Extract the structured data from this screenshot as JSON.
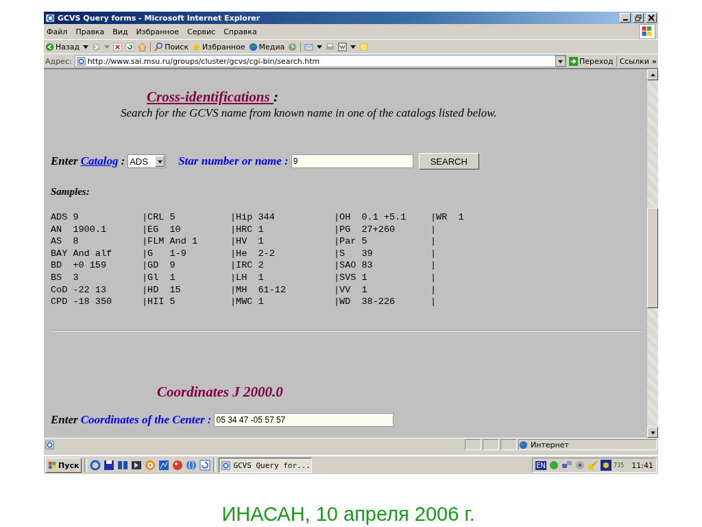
{
  "window": {
    "title": "GCVS Query forms - Microsoft Internet Explorer"
  },
  "menu": [
    "Файл",
    "Правка",
    "Вид",
    "Избранное",
    "Сервис",
    "Справка"
  ],
  "toolbar": {
    "back": "Назад",
    "search": "Поиск",
    "favorites": "Избранное",
    "media": "Медиа"
  },
  "address_bar": {
    "label": "Адрес:",
    "url": "http://www.sai.msu.ru/groups/cluster/gcvs/cgi-bin/search.htm",
    "go": "Переход",
    "links": "Ссылки",
    "more": "»"
  },
  "page": {
    "cross_title": "Cross-identifications ",
    "cross_colon": ":",
    "cross_subtitle": "Search for the GCVS name from known name in one of the catalogs listed below.",
    "enter": "Enter",
    "catalog_link": "Catalog",
    "colon": ":",
    "catalog_value": "ADS",
    "star_label": "Star number or name :",
    "star_value": "9",
    "search_button": "SEARCH",
    "samples_heading": "Samples:",
    "samples": [
      [
        "ADS 9",
        "|CRL 5",
        "|Hip 344",
        "|OH  0.1 +5.1",
        "|WR  1"
      ],
      [
        "AN  1900.1",
        "|EG  10",
        "|HRC 1",
        "|PG  27+260",
        "|"
      ],
      [
        "AS  8",
        "|FLM And 1",
        "|HV  1",
        "|Par 5",
        "|"
      ],
      [
        "BAY And alf",
        "|G   1-9",
        "|He  2-2",
        "|S   39",
        "|"
      ],
      [
        "BD  +0 159",
        "|GD  9",
        "|IRC 2",
        "|SAO 83",
        "|"
      ],
      [
        "BS  3",
        "|Gl  1",
        "|LH  1",
        "|SVS 1",
        "|"
      ],
      [
        "CoD -22 13",
        "|HD  15",
        "|MH  61-12",
        "|VV  1",
        "|"
      ],
      [
        "CPD -18 350",
        "|HII 5",
        "|MWC 1",
        "|WD  38-226",
        "|"
      ]
    ],
    "coords_title": "Coordinates J 2000.0",
    "coords_enter": "Enter",
    "coords_label": "Coordinates of the Center :",
    "coords_value": "05 34 47 -05 57 57"
  },
  "status_bar": {
    "zone": "Интернет"
  },
  "taskbar": {
    "start": "Пуск",
    "task": "GCVS Query for...",
    "lang": "EN",
    "tray_number": "735",
    "clock": "11:41"
  },
  "caption": "ИНАСАН, 10 апреля 2006 г."
}
